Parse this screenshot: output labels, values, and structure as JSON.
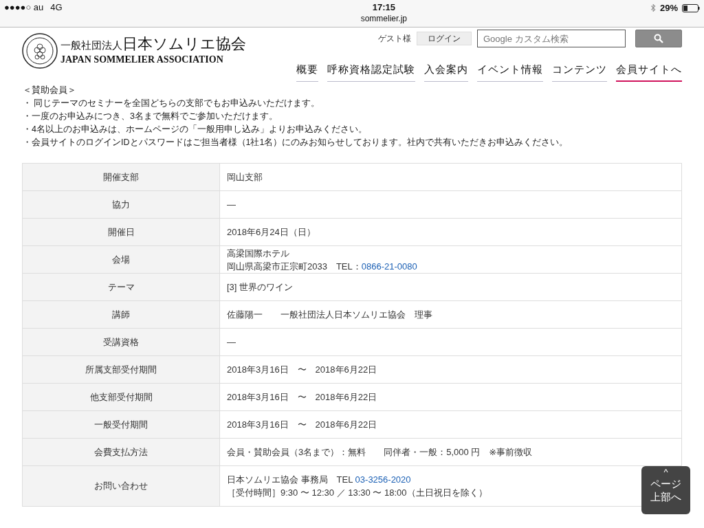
{
  "status_bar": {
    "carrier": "●●●●○ au",
    "network": "4G",
    "time": "17:15",
    "url": "sommelier.jp",
    "battery": "29%"
  },
  "header": {
    "logo_ja_small": "一般社団法人",
    "logo_ja": "日本ソムリエ協会",
    "logo_en": "JAPAN SOMMELIER ASSOCIATION",
    "guest": "ゲスト様",
    "login": "ログイン",
    "search": {
      "placeholder": "Google カスタム検索"
    },
    "nav": [
      {
        "label": "概要",
        "selected": false
      },
      {
        "label": "呼称資格認定試験",
        "selected": false
      },
      {
        "label": "入会案内",
        "selected": false
      },
      {
        "label": "イベント情報",
        "selected": false
      },
      {
        "label": "コンテンツ",
        "selected": false
      },
      {
        "label": "会員サイトへ",
        "selected": true
      }
    ]
  },
  "notes": {
    "heading": "＜賛助会員＞",
    "items": [
      "・ 同じテーマのセミナーを全国どちらの支部でもお申込みいただけます。",
      "・一度のお申込みにつき、3名まで無料でご参加いただけます。",
      "・4名以上のお申込みは、ホームページの「一般用申し込み」よりお申込みください。",
      "・会員サイトのログインIDとパスワードはご担当者様（1社1名）にのみお知らせしております。社内で共有いただきお申込みください。"
    ]
  },
  "table": {
    "rows": [
      {
        "label": "開催支部",
        "lines": [
          {
            "text": "岡山支部"
          }
        ]
      },
      {
        "label": "協力",
        "lines": [
          {
            "text": "—"
          }
        ]
      },
      {
        "label": "開催日",
        "lines": [
          {
            "text": "2018年6月24日（日）"
          }
        ]
      },
      {
        "label": "会場",
        "lines": [
          {
            "text": "高梁国際ホテル"
          },
          {
            "text": "岡山県高梁市正宗町2033　TEL：",
            "link": "0866-21-0080"
          }
        ]
      },
      {
        "label": "テーマ",
        "lines": [
          {
            "text": "[3] 世界のワイン"
          }
        ]
      },
      {
        "label": "講師",
        "lines": [
          {
            "text": "佐藤陽一　　一般社団法人日本ソムリエ協会　理事"
          }
        ]
      },
      {
        "label": "受講資格",
        "lines": [
          {
            "text": "—"
          }
        ]
      },
      {
        "label": "所属支部受付期間",
        "lines": [
          {
            "text": "2018年3月16日　〜　2018年6月22日"
          }
        ]
      },
      {
        "label": "他支部受付期間",
        "lines": [
          {
            "text": "2018年3月16日　〜　2018年6月22日"
          }
        ]
      },
      {
        "label": "一般受付期間",
        "lines": [
          {
            "text": "2018年3月16日　〜　2018年6月22日"
          }
        ]
      },
      {
        "label": "会費支払方法",
        "lines": [
          {
            "text": "会員・賛助会員（3名まで）：無料　　同伴者・一般：5,000 円　※事前徴収"
          }
        ]
      },
      {
        "label": "お問い合わせ",
        "lines": [
          {
            "text": "日本ソムリエ協会 事務局　TEL ",
            "link": "03-3256-2020"
          },
          {
            "text": "［受付時間］9:30 〜 12:30 ／ 13:30 〜 18:00（土日祝日を除く）"
          }
        ]
      }
    ]
  },
  "page_top": {
    "caret": "^",
    "label": "ページ上部へ"
  }
}
